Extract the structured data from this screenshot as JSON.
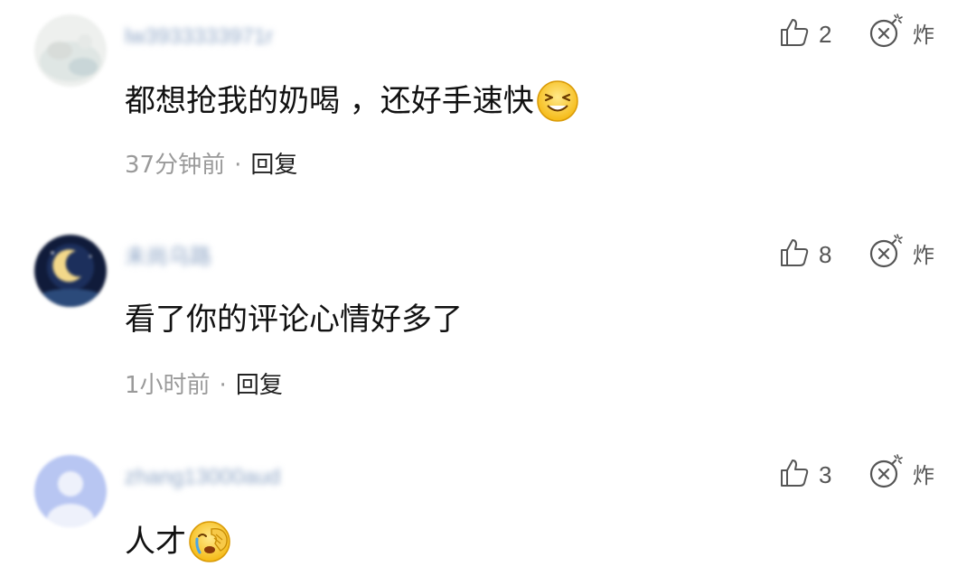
{
  "comments": [
    {
      "username": "lw3933333971r",
      "text": "都想抢我的奶喝 ，还好手速快",
      "emoji": "grinning-squint-face",
      "time": "37分钟前",
      "separator": "·",
      "reply_label": "回复",
      "likes": "2",
      "bomb_label": "炸"
    },
    {
      "username": "未尚乌路",
      "text": "看了你的评论心情好多了",
      "emoji": "",
      "time": "1小时前",
      "separator": "·",
      "reply_label": "回复",
      "likes": "8",
      "bomb_label": "炸"
    },
    {
      "username": "zhang13000aud",
      "text": "人才",
      "emoji": "face-palm-crying",
      "time": "",
      "separator": "",
      "reply_label": "",
      "likes": "3",
      "bomb_label": "炸"
    }
  ],
  "colors": {
    "text_primary": "#111111",
    "text_secondary": "#9a9a9a",
    "icon_gray": "#555555",
    "username_blur": "#8fa6c6"
  }
}
